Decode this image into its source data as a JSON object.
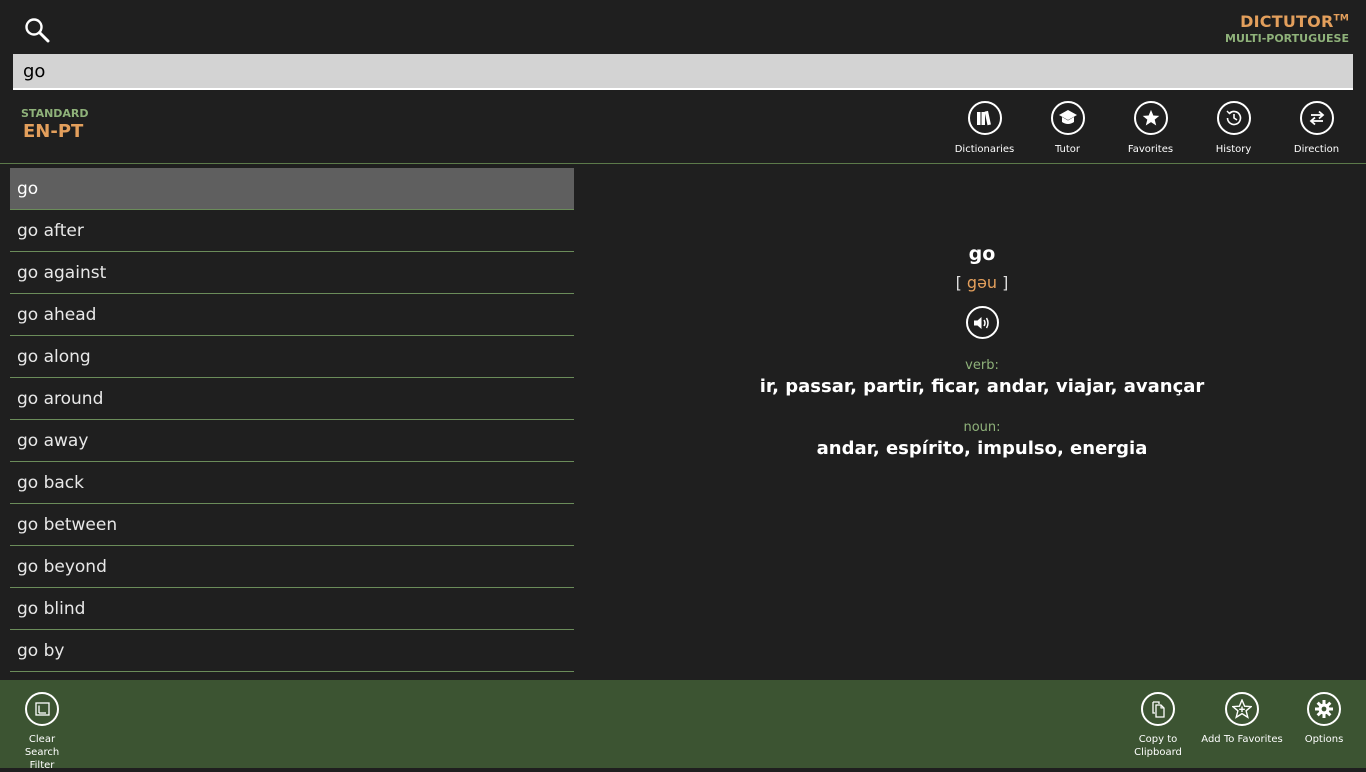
{
  "header": {
    "brand_name": "DICTUTOR",
    "brand_tm": "TM",
    "brand_sub": "MULTI-PORTUGUESE",
    "search_value": "go"
  },
  "dictionary": {
    "mode": "STANDARD",
    "pair": "EN-PT"
  },
  "toolbar": {
    "dictionaries": "Dictionaries",
    "tutor": "Tutor",
    "favorites": "Favorites",
    "history": "History",
    "direction": "Direction"
  },
  "word_list": [
    "go",
    "go after",
    "go against",
    "go ahead",
    "go along",
    "go around",
    "go away",
    "go back",
    "go between",
    "go beyond",
    "go blind",
    "go by"
  ],
  "entry": {
    "headword": "go",
    "bracket_open": "[",
    "pronunciation": "gəu",
    "bracket_close": "]",
    "senses": [
      {
        "pos": "verb:",
        "translations": "ir, passar, partir, ficar, andar, viajar, avançar"
      },
      {
        "pos": "noun:",
        "translations": "andar, espírito, impulso, energia"
      }
    ]
  },
  "appbar": {
    "clear_filter": "Clear Search Filter",
    "copy_clipboard": "Copy to Clipboard",
    "add_favorites": "Add To Favorites",
    "options": "Options"
  },
  "colors": {
    "accent": "#e39f5c",
    "green_text": "#8fb27a",
    "appbar_bg": "#3c5432"
  }
}
